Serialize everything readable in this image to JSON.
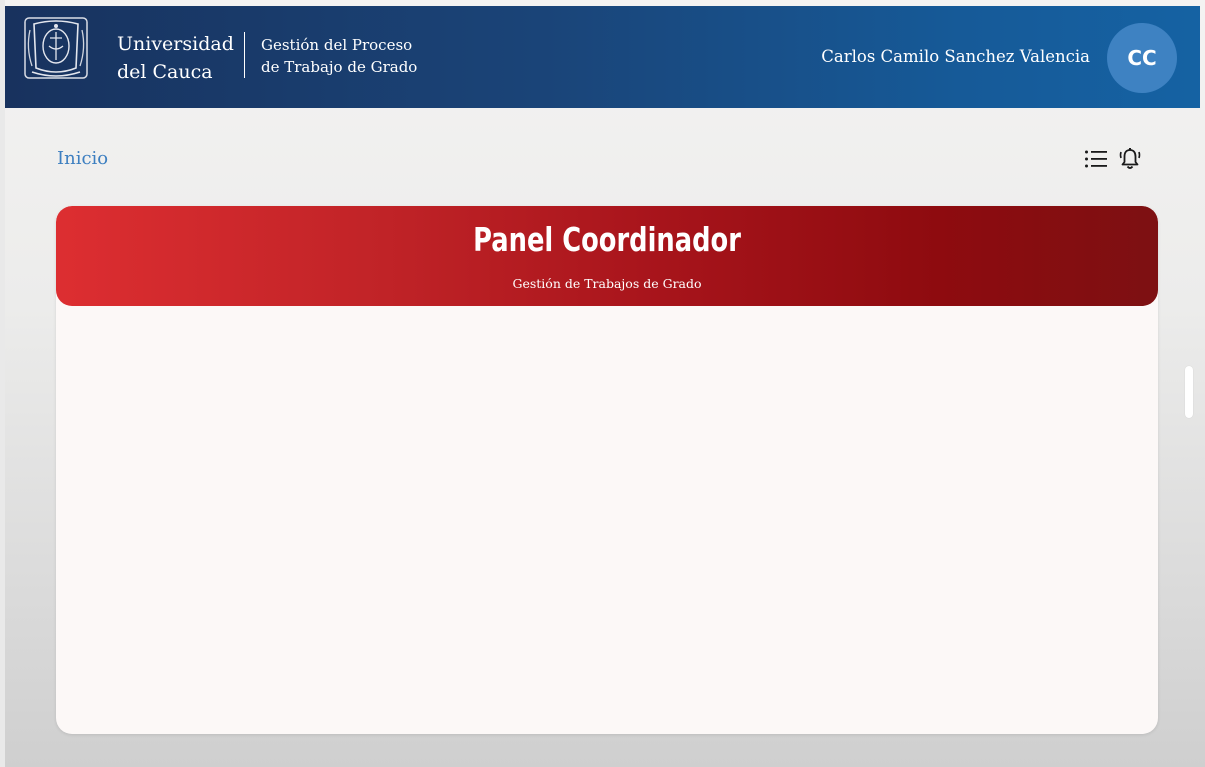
{
  "header": {
    "university_line1": "Universidad",
    "university_line2": "del Cauca",
    "app_title_line1": "Gestión del Proceso",
    "app_title_line2": "de Trabajo de Grado",
    "user_name": "Carlos Camilo Sanchez Valencia",
    "avatar_initials": "CC"
  },
  "breadcrumb": {
    "home_label": "Inicio"
  },
  "toolbar": {
    "icons": [
      "list-icon",
      "bell-icon"
    ]
  },
  "panel": {
    "title": "Panel Coordinador",
    "subtitle": "Gestión de Trabajos de Grado"
  },
  "colors": {
    "header_blue": "#1a4478",
    "avatar_blue": "#3e82c2",
    "link_blue": "#3d7fc0",
    "panel_red": "#c02327",
    "panel_dark_red": "#7d1012",
    "panel_body": "#fcf8f7"
  }
}
